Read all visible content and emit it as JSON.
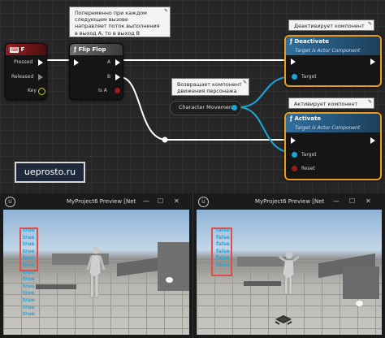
{
  "graph": {
    "comment_flipflop": [
      "Попеременно при каждом",
      "следующем вызове",
      "направляет поток выполнения",
      "в выход А, то в выход В"
    ],
    "comment_character": [
      "Возвращает компонент",
      "движения персонажа"
    ],
    "comment_deactivate": "Деактивирует компонент",
    "comment_activate": "Активирует компонент",
    "key_node": {
      "title": "F",
      "pins": [
        "Pressed",
        "Released",
        "Key"
      ]
    },
    "flipflop_node": {
      "title": "Flip Flop",
      "in": "",
      "out_a": "A",
      "out_b": "B",
      "is_a": "Is A"
    },
    "character_movement": {
      "label": "Character Movement"
    },
    "deactivate_node": {
      "title": "Deactivate",
      "subtitle": "Target is Actor Component",
      "target": "Target"
    },
    "activate_node": {
      "title": "Activate",
      "subtitle": "Target is Actor Component",
      "target": "Target",
      "reset": "Reset"
    },
    "watermark": "ueprosto.ru",
    "colors": {
      "exec": "#ffffff",
      "object_pin": "#1aa6d6",
      "bool_pin": "#a01818",
      "function_header": "#2a5f8a",
      "event_header": "#8a1d1d",
      "selected": "#e89c1a"
    }
  },
  "windows": [
    {
      "title": "MyProject6 Preview [Net",
      "debug_values": [
        "true",
        "true",
        "true",
        "true",
        "true",
        "true",
        "true",
        "true",
        "true",
        "true",
        "true",
        "true",
        "true"
      ]
    },
    {
      "title": "MyProject6 Preview [Net",
      "debug_values": [
        "false",
        "false",
        "false",
        "false",
        "false",
        "false"
      ]
    }
  ],
  "icons": [
    "minimize-icon",
    "maximize-icon",
    "close-icon",
    "unreal-logo-icon"
  ]
}
